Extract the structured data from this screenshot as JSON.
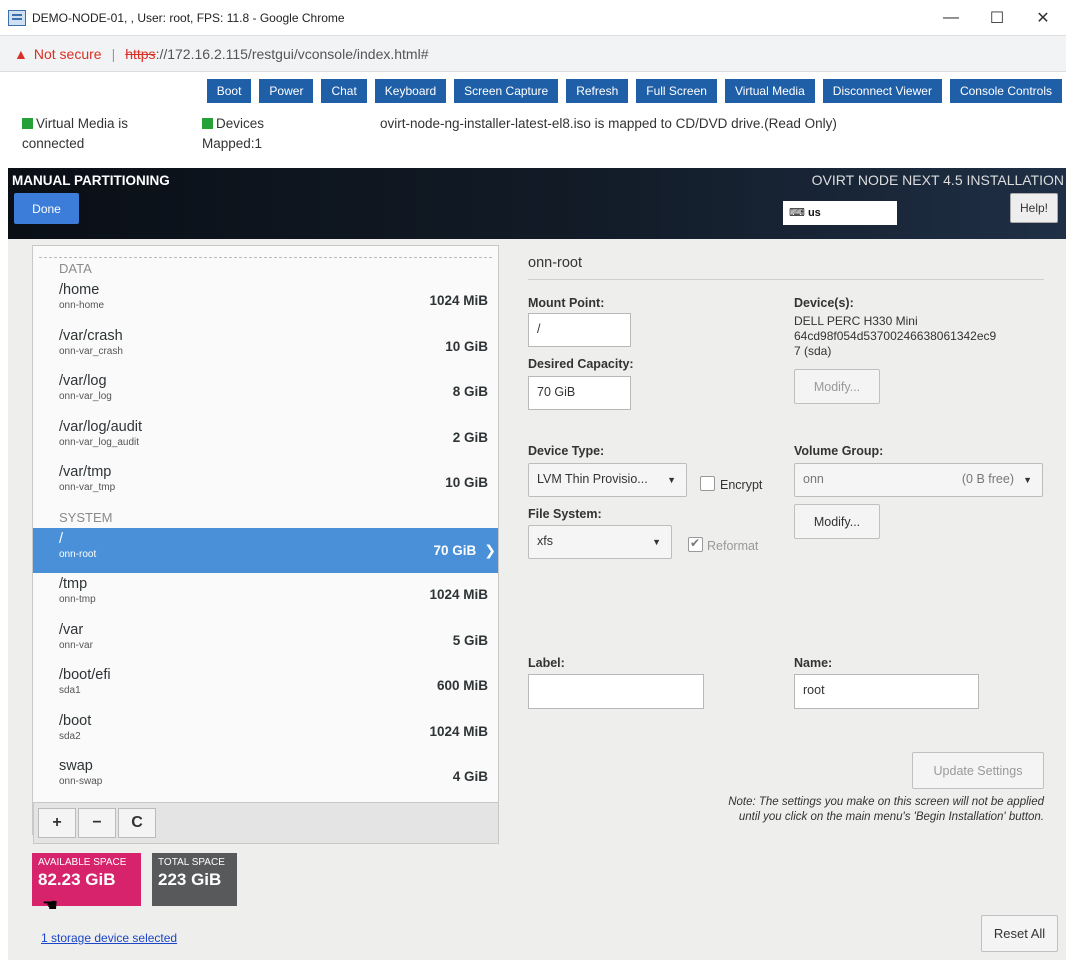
{
  "window": {
    "title": "DEMO-NODE-01, , User: root, FPS: 11.8 - Google Chrome",
    "minimize": "—",
    "maximize": "☐",
    "close": "✕"
  },
  "address": {
    "not_secure": "Not secure",
    "scheme": "https",
    "url_rest": "://172.16.2.115/restgui/vconsole/index.html#"
  },
  "toolbar": {
    "buttons": [
      "Boot",
      "Power",
      "Chat",
      "Keyboard",
      "Screen Capture",
      "Refresh",
      "Full Screen",
      "Virtual Media",
      "Disconnect Viewer",
      "Console Controls"
    ]
  },
  "status": {
    "vm_line1": "Virtual Media is",
    "vm_line2": "connected",
    "dev_line1": "Devices",
    "dev_line2": "Mapped:1",
    "mapped": "ovirt-node-ng-installer-latest-el8.iso is mapped to CD/DVD drive.(Read Only)"
  },
  "header": {
    "title": "MANUAL PARTITIONING",
    "done": "Done",
    "product": "OVIRT NODE NEXT 4.5 INSTALLATION",
    "keyboard": "us",
    "help": "Help!"
  },
  "partitions": {
    "data_label": "DATA",
    "system_label": "SYSTEM",
    "data": [
      {
        "mount": "/home",
        "device": "onn-home",
        "size": "1024 MiB"
      },
      {
        "mount": "/var/crash",
        "device": "onn-var_crash",
        "size": "10 GiB"
      },
      {
        "mount": "/var/log",
        "device": "onn-var_log",
        "size": "8 GiB"
      },
      {
        "mount": "/var/log/audit",
        "device": "onn-var_log_audit",
        "size": "2 GiB"
      },
      {
        "mount": "/var/tmp",
        "device": "onn-var_tmp",
        "size": "10 GiB"
      }
    ],
    "system": [
      {
        "mount": "/",
        "device": "onn-root",
        "size": "70 GiB"
      },
      {
        "mount": "/tmp",
        "device": "onn-tmp",
        "size": "1024 MiB"
      },
      {
        "mount": "/var",
        "device": "onn-var",
        "size": "5 GiB"
      },
      {
        "mount": "/boot/efi",
        "device": "sda1",
        "size": "600 MiB"
      },
      {
        "mount": "/boot",
        "device": "sda2",
        "size": "1024 MiB"
      },
      {
        "mount": "swap",
        "device": "onn-swap",
        "size": "4 GiB"
      }
    ]
  },
  "buttons": {
    "add": "+",
    "remove": "−",
    "refresh": "C"
  },
  "space": {
    "available_label": "AVAILABLE SPACE",
    "available_value": "82.23 GiB",
    "total_label": "TOTAL SPACE",
    "total_value": "223 GiB"
  },
  "storage_link": "1 storage device selected",
  "reset_all": "Reset All",
  "details": {
    "title": "onn-root",
    "mount_point_label": "Mount Point:",
    "mount_point": "/",
    "desired_capacity_label": "Desired Capacity:",
    "desired_capacity": "70 GiB",
    "devices_label": "Device(s):",
    "device_line1": "DELL PERC H330 Mini",
    "device_line2": "64cd98f054d53700246638061342ec9",
    "device_line3": "7 (sda)",
    "modify": "Modify...",
    "device_type_label": "Device Type:",
    "device_type": "LVM Thin Provisio...",
    "encrypt": "Encrypt",
    "volume_group_label": "Volume Group:",
    "volume_group": "onn",
    "vg_free": "(0 B free)",
    "file_system_label": "File System:",
    "file_system": "xfs",
    "reformat": "Reformat",
    "label_label": "Label:",
    "label_value": "",
    "name_label": "Name:",
    "name_value": "root",
    "update_settings": "Update Settings",
    "note": "Note:  The settings you make on this screen will not be applied until you click on the main menu's 'Begin Installation' button."
  }
}
